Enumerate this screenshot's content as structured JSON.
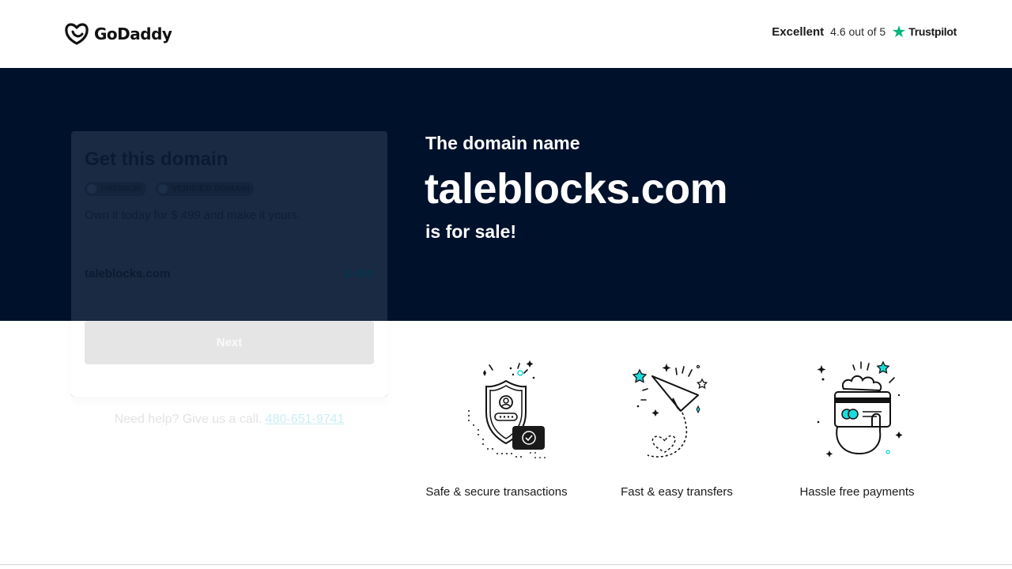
{
  "header": {
    "logo_text": "GoDaddy",
    "rating_label": "Excellent",
    "rating_score": "4.6 out of 5",
    "rating_brand": "Trustpilot"
  },
  "hero": {
    "intro": "The domain name",
    "domain": "taleblocks.com",
    "suffix": "is for sale!"
  },
  "offer_card": {
    "title": "Get this domain",
    "badges": [
      "PREMIUM",
      "VERIFIED DOMAIN"
    ],
    "description": "Own it today for $ 499 and make it yours.",
    "item_name": "taleblocks.com",
    "item_price": "$ 499",
    "next_label": "Next"
  },
  "help": {
    "text": "Need help? Give us a call.",
    "phone": "480-651-9741"
  },
  "features": [
    {
      "label": "Safe & secure transactions",
      "icon": "shield-user-icon"
    },
    {
      "label": "Fast & easy transfers",
      "icon": "paper-plane-icon"
    },
    {
      "label": "Hassle free payments",
      "icon": "hand-card-icon"
    }
  ],
  "colors": {
    "hero_bg": "#00112c",
    "accent_teal": "#1bdbdb",
    "trustpilot_green": "#00b67a"
  }
}
